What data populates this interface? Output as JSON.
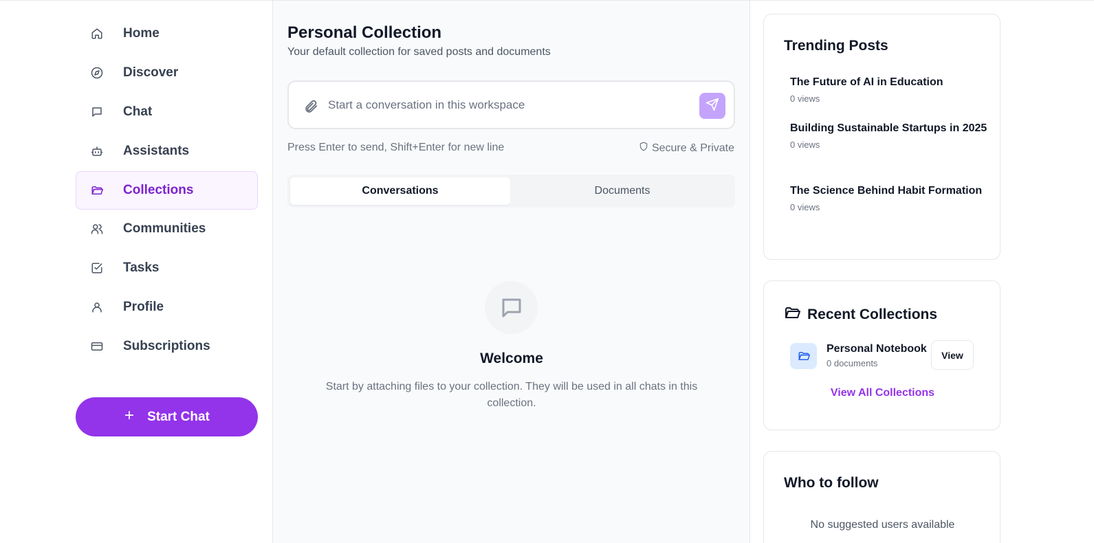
{
  "sidebar": {
    "items": [
      {
        "label": "Home",
        "icon": "home-icon"
      },
      {
        "label": "Discover",
        "icon": "compass-icon"
      },
      {
        "label": "Chat",
        "icon": "chat-icon"
      },
      {
        "label": "Assistants",
        "icon": "bot-icon"
      },
      {
        "label": "Collections",
        "icon": "folder-icon",
        "active": true
      },
      {
        "label": "Communities",
        "icon": "users-icon"
      },
      {
        "label": "Tasks",
        "icon": "checkbox-icon"
      },
      {
        "label": "Profile",
        "icon": "user-icon"
      },
      {
        "label": "Subscriptions",
        "icon": "card-icon"
      }
    ],
    "start_chat_label": "Start Chat"
  },
  "main": {
    "title": "Personal Collection",
    "subtitle": "Your default collection for saved posts and documents",
    "composer": {
      "placeholder": "Start a conversation in this workspace",
      "value": ""
    },
    "hint": "Press Enter to send, Shift+Enter for new line",
    "secure": "Secure & Private",
    "tabs": [
      {
        "label": "Conversations",
        "active": true
      },
      {
        "label": "Documents",
        "active": false
      }
    ],
    "empty": {
      "title": "Welcome",
      "text": "Start by attaching files to your collection. They will be used in all chats in this collection."
    }
  },
  "trending": {
    "title": "Trending Posts",
    "posts": [
      {
        "title": "The Future of AI in Education",
        "views": "0 views"
      },
      {
        "title": "Building Sustainable Startups in 2025",
        "views": "0 views"
      },
      {
        "title": "The Science Behind Habit Formation",
        "views": "0 views"
      }
    ]
  },
  "recent_collections": {
    "title": "Recent Collections",
    "items": [
      {
        "name": "Personal Notebook",
        "count": "0 documents",
        "button": "View"
      }
    ],
    "view_all": "View All Collections"
  },
  "who_to_follow": {
    "title": "Who to follow",
    "empty": "No suggested users available"
  },
  "colors": {
    "accent": "#9333ea",
    "accent_light": "#c4a4fb",
    "active_bg": "#faf5ff",
    "active_text": "#7e22ce"
  }
}
